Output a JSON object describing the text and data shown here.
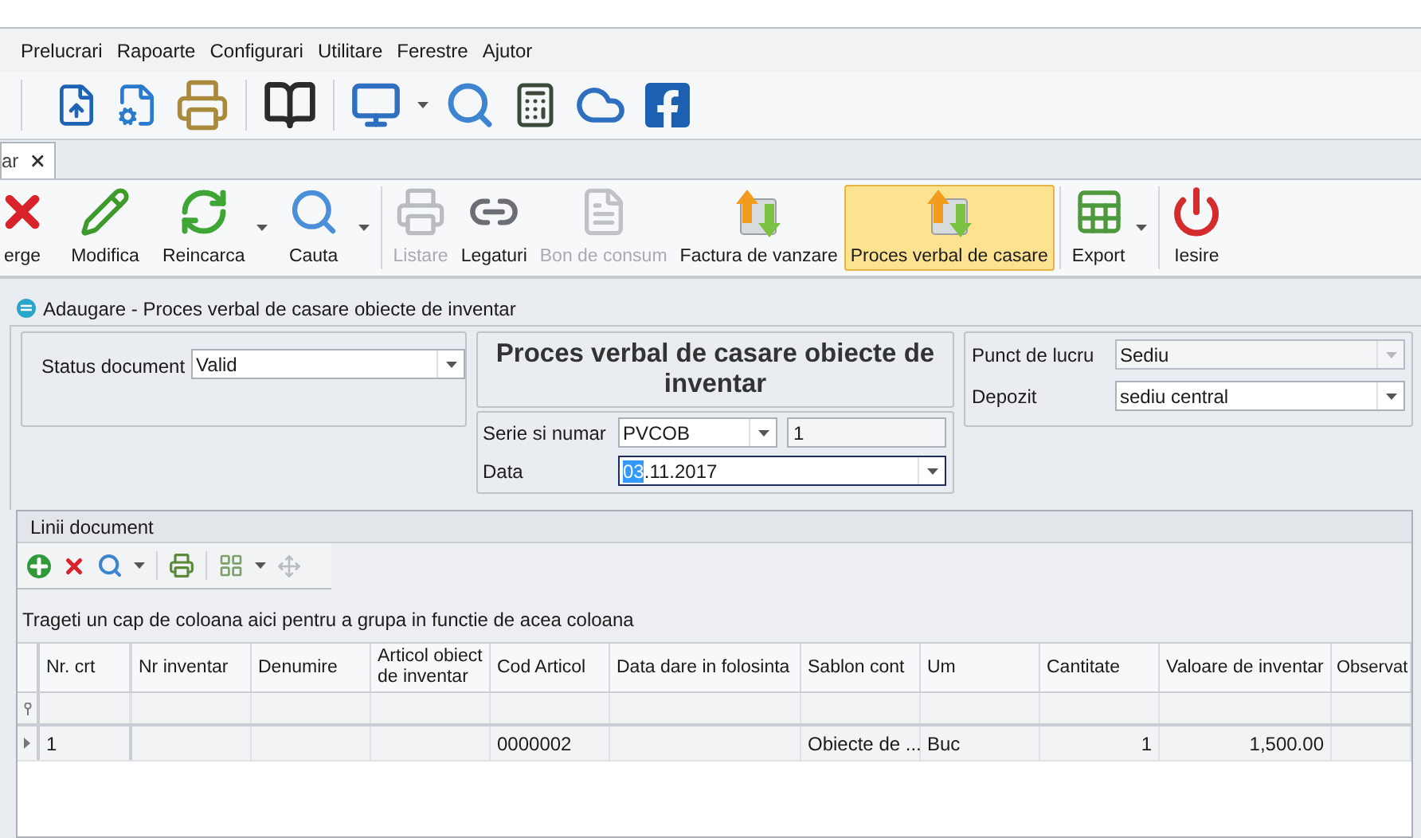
{
  "menu": [
    "Prelucrari",
    "Rapoarte",
    "Configurari",
    "Utilitare",
    "Ferestre",
    "Ajutor"
  ],
  "document_tab": {
    "title": "ar"
  },
  "ribbon": [
    {
      "label": "erge",
      "disabled": false,
      "selected": false,
      "has_menu": false
    },
    {
      "label": "Modifica",
      "disabled": false,
      "selected": false,
      "has_menu": false
    },
    {
      "label": "Reincarca",
      "disabled": false,
      "selected": false,
      "has_menu": true
    },
    {
      "label": "Cauta",
      "disabled": false,
      "selected": false,
      "has_menu": true
    },
    {
      "label": "Listare",
      "disabled": true,
      "selected": false,
      "has_menu": false
    },
    {
      "label": "Legaturi",
      "disabled": false,
      "selected": false,
      "has_menu": false
    },
    {
      "label": "Bon de consum",
      "disabled": true,
      "selected": false,
      "has_menu": false
    },
    {
      "label": "Factura de vanzare",
      "disabled": false,
      "selected": false,
      "has_menu": false
    },
    {
      "label": "Proces verbal de casare",
      "disabled": false,
      "selected": true,
      "has_menu": false
    },
    {
      "label": "Export",
      "disabled": false,
      "selected": false,
      "has_menu": true
    },
    {
      "label": "Iesire",
      "disabled": false,
      "selected": false,
      "has_menu": false
    }
  ],
  "form": {
    "title": "Adaugare - Proces verbal de casare obiecte de inventar",
    "heading": "Proces verbal de casare obiecte de inventar",
    "status": {
      "label": "Status document",
      "value": "Valid"
    },
    "serie": {
      "label": "Serie si numar",
      "value": "PVCOB",
      "number": "1"
    },
    "data": {
      "label": "Data",
      "selected_part": "03",
      "value_rest": ".11.2017",
      "focused": true
    },
    "punct": {
      "label": "Punct de lucru",
      "value": "Sediu",
      "disabled": true
    },
    "depozit": {
      "label": "Depozit",
      "value": "sediu central",
      "disabled": false
    }
  },
  "lines": {
    "title": "Linii document",
    "group_hint": "Trageti un cap de coloana aici pentru a grupa in functie de acea coloana",
    "columns": [
      {
        "label": "Nr. crt",
        "numeric": false
      },
      {
        "label": "Nr inventar"
      },
      {
        "label": "Denumire"
      },
      {
        "label": "Articol obiect de inventar"
      },
      {
        "label": "Cod Articol",
        "numeric": false
      },
      {
        "label": "Data dare in folosinta",
        "numeric": false
      },
      {
        "label": "Sablon cont",
        "numeric": false
      },
      {
        "label": "Um",
        "numeric": false
      },
      {
        "label": "Cantitate",
        "numeric": true
      },
      {
        "label": "Valoare de inventar",
        "numeric": true
      },
      {
        "label": "Observat"
      }
    ],
    "rows": [
      {
        "selected": true,
        "cells": [
          "1",
          null,
          null,
          null,
          "0000002",
          null,
          "Obiecte de ...",
          "Buc",
          "1",
          "1,500.00",
          null
        ]
      }
    ]
  }
}
